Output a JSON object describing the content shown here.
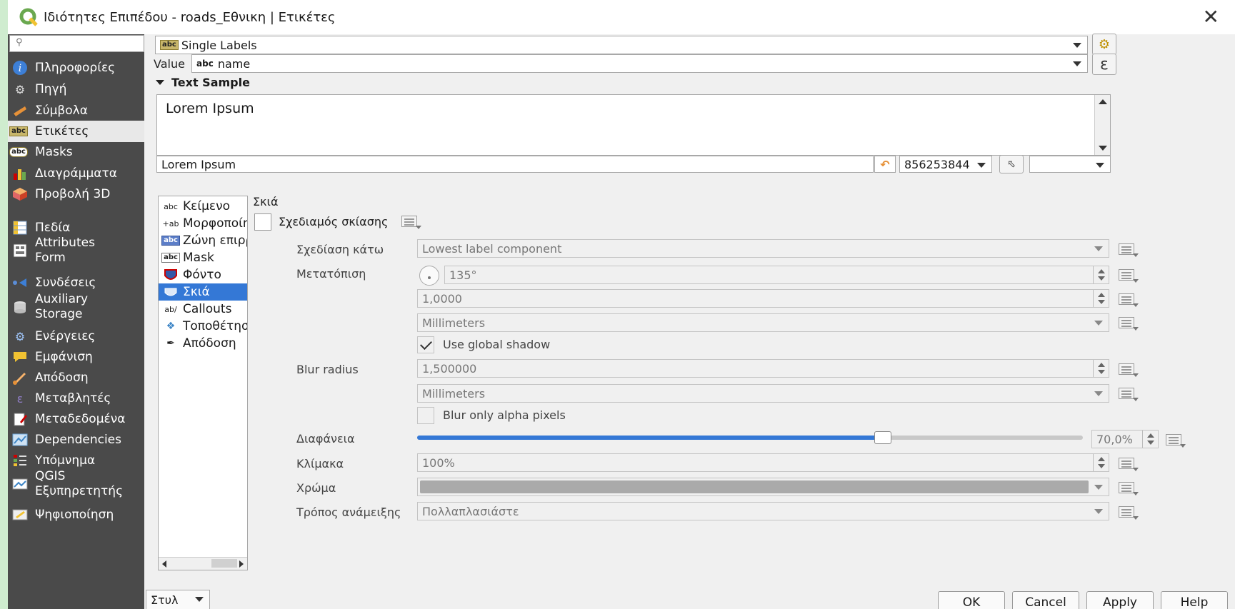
{
  "window": {
    "title": "Ιδιότητες Επιπέδου - roads_Εθνικη | Ετικέτες",
    "close_glyph": "✕"
  },
  "sidebar": {
    "search_placeholder": "",
    "items": [
      {
        "label": "Πληροφορίες",
        "icon": "info-icon"
      },
      {
        "label": "Πηγή",
        "icon": "source-icon"
      },
      {
        "label": "Σύμβολα",
        "icon": "symbology-icon"
      },
      {
        "label": "Ετικέτες",
        "icon": "labels-icon"
      },
      {
        "label": "Masks",
        "icon": "masks-icon"
      },
      {
        "label": "Διαγράμματα",
        "icon": "diagrams-icon"
      },
      {
        "label": "Προβολή 3D",
        "icon": "3d-view-icon"
      },
      {
        "label": "Πεδία",
        "icon": "fields-icon"
      },
      {
        "label": "Attributes Form",
        "label_l1": "Attributes",
        "label_l2": "Form",
        "icon": "attributes-form-icon"
      },
      {
        "label": "Συνδέσεις",
        "icon": "joins-icon"
      },
      {
        "label": "Auxiliary Storage",
        "label_l1": "Auxiliary",
        "label_l2": "Storage",
        "icon": "auxiliary-storage-icon"
      },
      {
        "label": "Ενέργειες",
        "icon": "actions-icon"
      },
      {
        "label": "Εμφάνιση",
        "icon": "display-icon"
      },
      {
        "label": "Απόδοση",
        "icon": "rendering-icon"
      },
      {
        "label": "Μεταβλητές",
        "icon": "variables-icon"
      },
      {
        "label": "Μεταδεδομένα",
        "icon": "metadata-icon"
      },
      {
        "label": "Dependencies",
        "icon": "dependencies-icon"
      },
      {
        "label": "Υπόμνημα",
        "icon": "legend-icon"
      },
      {
        "label": "QGIS Εξυπηρετητής",
        "label_l1": "QGIS",
        "label_l2": "Εξυπηρετητής",
        "icon": "qgis-server-icon"
      },
      {
        "label": "Ψηφιοποίηση",
        "icon": "digitizing-icon"
      }
    ]
  },
  "labeling": {
    "mode": "Single Labels",
    "value_label": "Value",
    "value_field": "name",
    "abc": "abc",
    "epsilon": "ε"
  },
  "text_sample": {
    "header": "Text Sample",
    "preview_text": "Lorem Ipsum",
    "input_value": "Lorem Ipsum",
    "scale_value": "856253844"
  },
  "tabs": [
    {
      "label": "Κείμενο",
      "icon": "text-icon"
    },
    {
      "label": "Μορφοποίηση",
      "icon": "formatting-icon"
    },
    {
      "label": "Ζώνη επιρροής",
      "icon": "buffer-icon"
    },
    {
      "label": "Mask",
      "icon": "mask-icon"
    },
    {
      "label": "Φόντο",
      "icon": "background-icon"
    },
    {
      "label": "Σκιά",
      "icon": "shadow-icon"
    },
    {
      "label": "Callouts",
      "icon": "callouts-icon"
    },
    {
      "label": "Τοποθέτηση",
      "icon": "placement-icon"
    },
    {
      "label": "Απόδοση",
      "icon": "rendering-tab-icon"
    }
  ],
  "shadow": {
    "section_title": "Σκιά",
    "draw_label": "Σχεδιαμός σκίασης",
    "draw_under_label": "Σχεδίαση κάτω",
    "draw_under_value": "Lowest label component",
    "offset_label": "Μετατόπιση",
    "offset_angle": "135°",
    "offset_distance": "1,0000",
    "offset_units": "Millimeters",
    "use_global_label": "Use global shadow",
    "blur_label": "Blur radius",
    "blur_value": "1,500000",
    "blur_units": "Millimeters",
    "blur_alpha_label": "Blur only alpha pixels",
    "opacity_label": "Διαφάνεια",
    "opacity_value": "70,0%",
    "opacity_fraction": 0.7,
    "scale_label": "Κλίμακα",
    "scale_value": "100%",
    "color_label": "Χρώμα",
    "color_hex": "#aaaaaa",
    "blend_label": "Τρόπος ανάμειξης",
    "blend_value": "Πολλαπλασιάστε"
  },
  "footer": {
    "style_label": "Στυλ",
    "ok": "OK",
    "cancel": "Cancel",
    "apply": "Apply",
    "help": "Help"
  }
}
